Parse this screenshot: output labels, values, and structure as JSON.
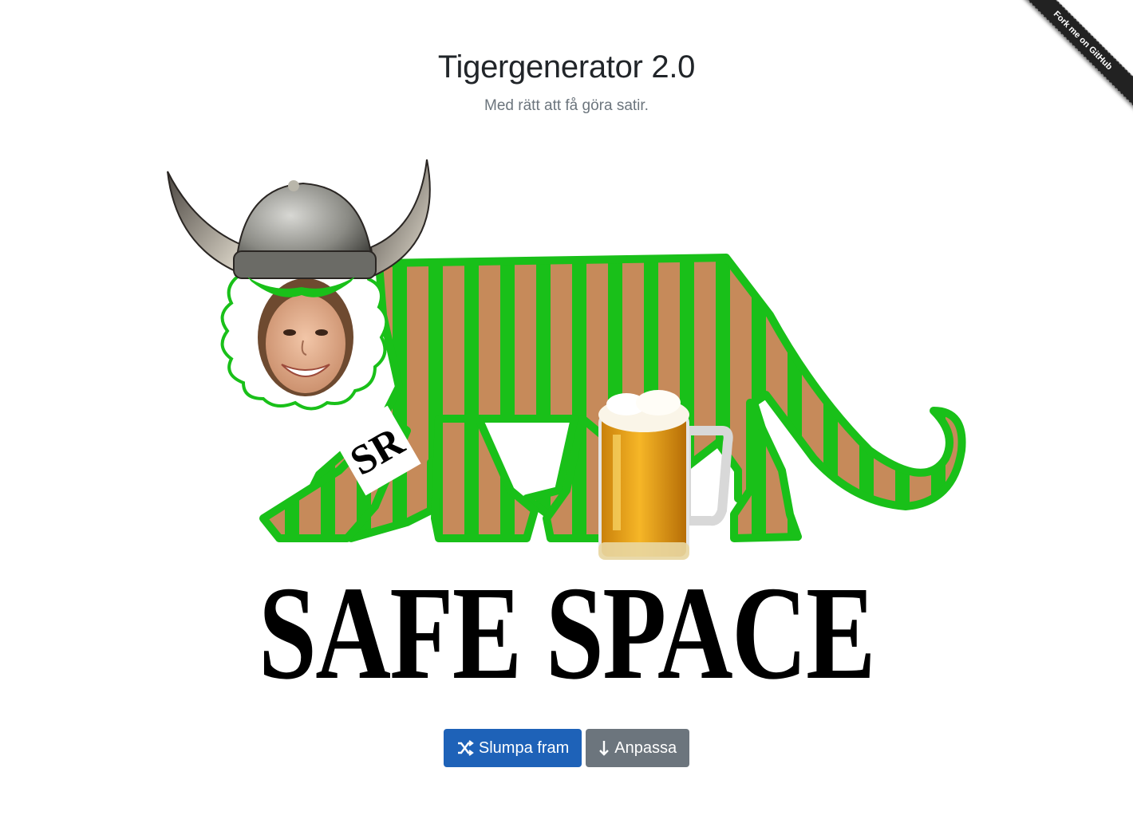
{
  "header": {
    "title": "Tigergenerator 2.0",
    "subtitle": "Med rätt att få göra satir."
  },
  "ribbon": {
    "label": "Fork me on GitHub"
  },
  "image": {
    "slogan": "SAFE SPACE",
    "badge_text": "SR",
    "stripe_color": "#19c019",
    "body_color": "#c68a5a"
  },
  "actions": {
    "shuffle_label": "Slumpa fram",
    "shuffle_icon": "shuffle-icon",
    "customize_label": "Anpassa",
    "customize_icon": "arrow-down-icon"
  },
  "colors": {
    "primary": "#1e62b8",
    "secondary": "#6c757d"
  }
}
